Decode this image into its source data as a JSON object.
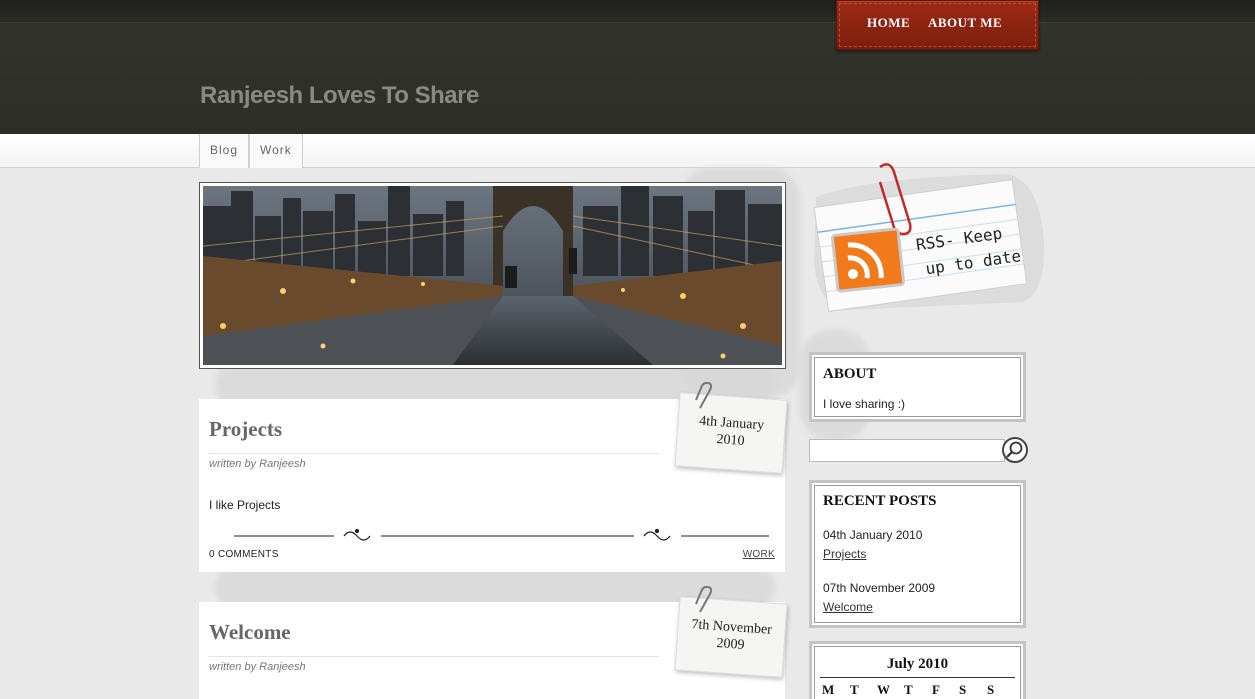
{
  "site": {
    "title": "Ranjeesh Loves To Share"
  },
  "topnav": {
    "items": [
      {
        "label": "HOME"
      },
      {
        "label": "ABOUT ME"
      }
    ]
  },
  "subnav": {
    "tabs": [
      {
        "label": "Blog"
      },
      {
        "label": "Work"
      }
    ]
  },
  "posts": [
    {
      "title": "Projects",
      "byline": "written by Ranjeesh",
      "date_line1": "4th January",
      "date_line2": "2010",
      "body": "I like Projects",
      "comments": "0 COMMENTS",
      "category": "WORK"
    },
    {
      "title": "Welcome",
      "byline": "written by Ranjeesh",
      "date_line1": "7th November",
      "date_line2": "2009"
    }
  ],
  "sidebar": {
    "rss": {
      "line1": "RSS- Keep",
      "line2": "up to date"
    },
    "about": {
      "heading": "ABOUT",
      "text": "I love sharing :)"
    },
    "search": {
      "placeholder": ""
    },
    "recent_posts": {
      "heading": "RECENT POSTS",
      "items": [
        {
          "date": "04th January 2010",
          "title": "Projects"
        },
        {
          "date": "07th November 2009",
          "title": "Welcome"
        }
      ]
    },
    "calendar": {
      "heading": "July 2010",
      "days": [
        "M",
        "T",
        "W",
        "T",
        "F",
        "S",
        "S"
      ]
    }
  },
  "colors": {
    "header_bg": "#2e2e29",
    "nav_red": "#8a2312",
    "page_bg": "#e9e9e9",
    "rss_orange": "#f07a1c"
  }
}
